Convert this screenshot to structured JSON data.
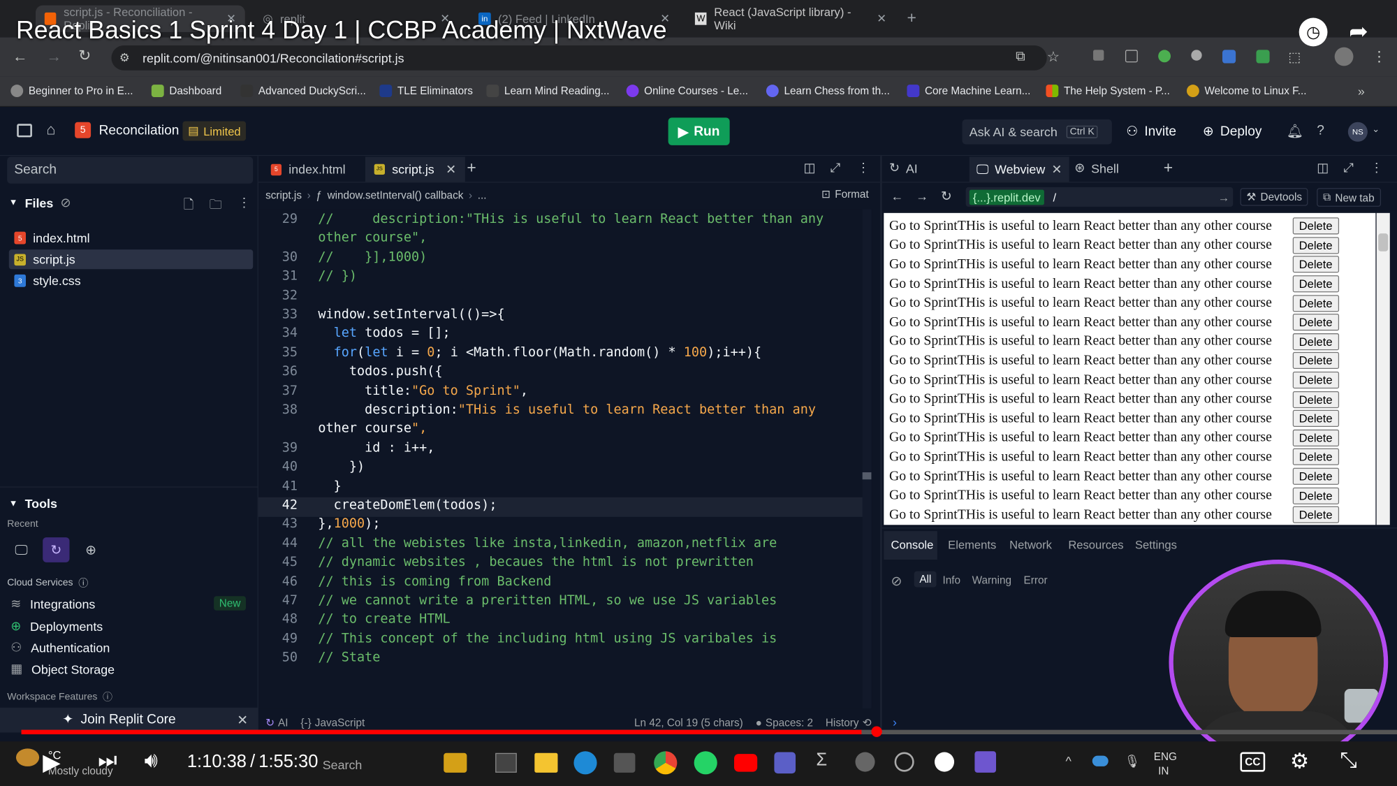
{
  "video": {
    "title": "React Basics 1 Sprint 4 Day 1 | CCBP Academy | NxtWave",
    "time_current": "1:10:38",
    "time_total": "1:55:30",
    "progress": 0.611,
    "caption_btn": "CC"
  },
  "browser": {
    "tabs": [
      {
        "label": "script.js - Reconciliation - Replit"
      },
      {
        "label": "replit"
      },
      {
        "label": "(2) Feed | LinkedIn"
      },
      {
        "label": "React (JavaScript library) - Wiki"
      }
    ],
    "url": "replit.com/@nitinsan001/Reconcilation#script.js",
    "bookmarks": [
      "Beginner to Pro in E...",
      "Dashboard",
      "Advanced DuckyScri...",
      "TLE Eliminators",
      "Learn Mind Reading...",
      "Online Courses - Le...",
      "Learn Chess from th...",
      "Core Machine Learn...",
      "The Help System - P...",
      "Welcome to Linux F..."
    ]
  },
  "replit": {
    "project": "Reconcilation",
    "plan_badge": "Limited",
    "run_label": "Run",
    "ask_ai": "Ask AI & search",
    "ask_ai_shortcut": "Ctrl K",
    "invite": "Invite",
    "deploy": "Deploy",
    "avatar": "NS",
    "search_placeholder": "Search",
    "files_label": "Files",
    "files": [
      "index.html",
      "script.js",
      "style.css"
    ],
    "tools_label": "Tools",
    "recent_label": "Recent",
    "cloud_services_label": "Cloud Services",
    "cloud_services": [
      {
        "label": "Integrations",
        "badge": "New"
      },
      {
        "label": "Deployments"
      },
      {
        "label": "Authentication"
      },
      {
        "label": "Object Storage"
      }
    ],
    "workspace_features": "Workspace Features",
    "join_core": "Join Replit Core"
  },
  "editor": {
    "tabs": [
      "index.html",
      "script.js"
    ],
    "breadcrumb": [
      "script.js",
      "window.setInterval() callback",
      "..."
    ],
    "format_btn": "Format",
    "lines": [
      {
        "n": "29",
        "text": "//     description:\"THis is useful to learn React better than any"
      },
      {
        "n": "",
        "text": "other course\","
      },
      {
        "n": "30",
        "text": "//    }],1000)"
      },
      {
        "n": "31",
        "text": "// })"
      },
      {
        "n": "32",
        "text": ""
      },
      {
        "n": "33",
        "text": "window.setInterval(()=>{"
      },
      {
        "n": "34",
        "text": "  let todos = [];"
      },
      {
        "n": "35",
        "text": "  for(let i = 0; i <Math.floor(Math.random() * 100);i++){"
      },
      {
        "n": "36",
        "text": "    todos.push({"
      },
      {
        "n": "37",
        "text": "      title:\"Go to Sprint\","
      },
      {
        "n": "38",
        "text": "      description:\"THis is useful to learn React better than any"
      },
      {
        "n": "",
        "text": "other course\","
      },
      {
        "n": "39",
        "text": "      id : i++,"
      },
      {
        "n": "40",
        "text": "    })"
      },
      {
        "n": "41",
        "text": "  }"
      },
      {
        "n": "42",
        "text": "  createDomElem(todos);"
      },
      {
        "n": "43",
        "text": "},1000);"
      },
      {
        "n": "44",
        "text": "// all the webistes like insta,linkedin, amazon,netflix are"
      },
      {
        "n": "45",
        "text": "// dynamic websites , becaues the html is not prewritten"
      },
      {
        "n": "46",
        "text": "// this is coming from Backend"
      },
      {
        "n": "47",
        "text": "// we cannot write a preritten HTML, so we use JS variables"
      },
      {
        "n": "48",
        "text": "// to create HTML"
      },
      {
        "n": "49",
        "text": "// This concept of the including html using JS varibales is"
      },
      {
        "n": "50",
        "text": "// State"
      }
    ],
    "status_ai": "AI",
    "status_lang": "JavaScript",
    "status_pos": "Ln 42, Col 19 (5 chars)",
    "status_spaces": "Spaces: 2",
    "status_history": "History"
  },
  "webview": {
    "tabs": [
      "AI",
      "Webview",
      "Shell"
    ],
    "host": "{...}.replit.dev",
    "path": "/",
    "devtools": "Devtools",
    "new_tab": "New tab",
    "todo_text": "Go to SprintTHis is useful to learn React better than any other course",
    "delete_label": "Delete",
    "console_tabs": [
      "Console",
      "Elements",
      "Network",
      "Resources",
      "Settings"
    ],
    "filters": [
      "All",
      "Info",
      "Warning",
      "Error"
    ]
  },
  "taskbar": {
    "weather_temp": "°C",
    "weather_desc": "Mostly cloudy",
    "search": "Search",
    "lang1": "ENG",
    "lang2": "IN"
  }
}
